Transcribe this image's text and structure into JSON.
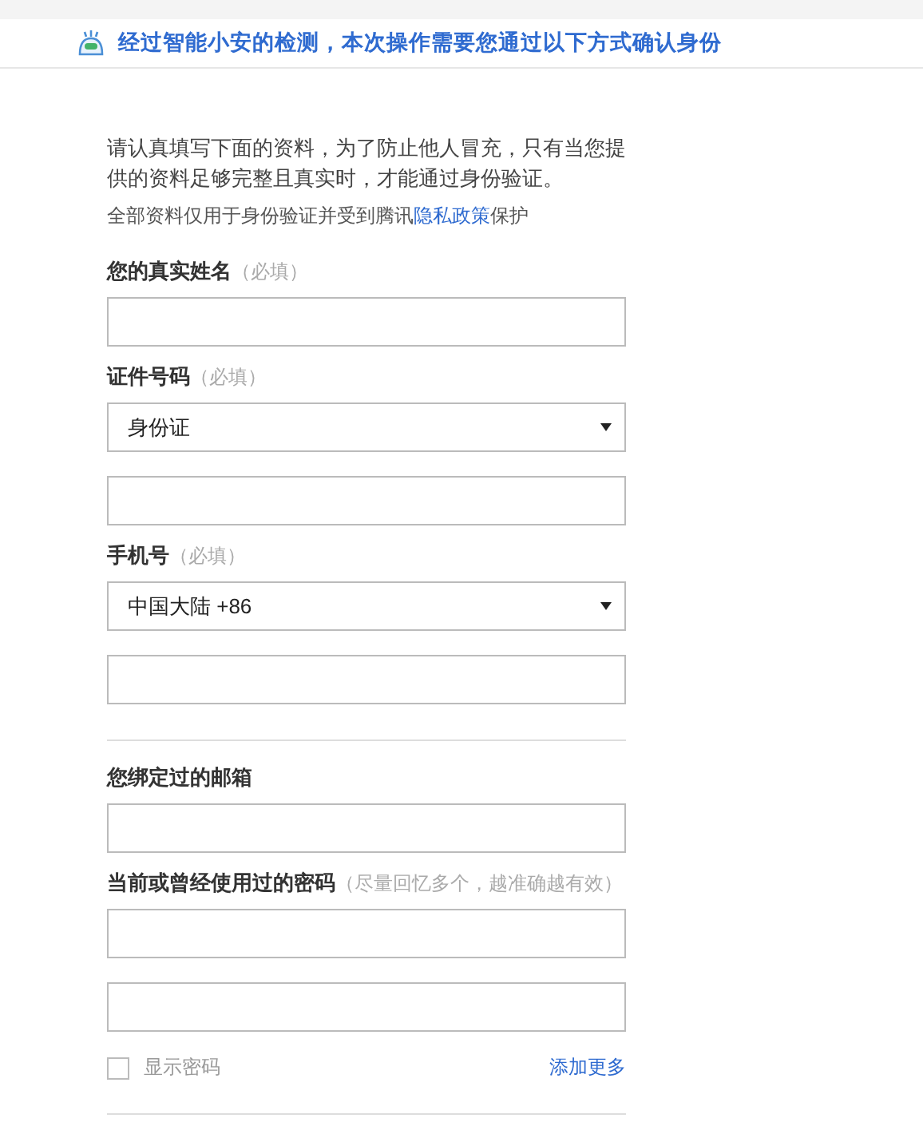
{
  "banner": {
    "text": "经过智能小安的检测，本次操作需要您通过以下方式确认身份"
  },
  "intro": "请认真填写下面的资料，为了防止他人冒充，只有当您提供的资料足够完整且真实时，才能通过身份验证。",
  "privacy": {
    "prefix": "全部资料仅用于身份验证并受到腾讯",
    "link": "隐私政策",
    "suffix": "保护"
  },
  "items": [
    {
      "kind": "field",
      "label": "您的真实姓名",
      "hint": "（必填）",
      "controls": [
        {
          "kind": "input"
        }
      ]
    },
    {
      "kind": "field",
      "label": "证件号码",
      "hint": "（必填）",
      "controls": [
        {
          "kind": "select",
          "value": "身份证"
        },
        {
          "kind": "input"
        }
      ]
    },
    {
      "kind": "field",
      "label": "手机号",
      "hint": "（必填）",
      "controls": [
        {
          "kind": "select",
          "value": "中国大陆 +86"
        },
        {
          "kind": "input"
        }
      ]
    },
    {
      "kind": "divider"
    },
    {
      "kind": "field",
      "label": "您绑定过的邮箱",
      "controls": [
        {
          "kind": "input"
        }
      ]
    },
    {
      "kind": "field",
      "label": "当前或曾经使用过的密码",
      "hint": "（尽量回忆多个，越准确越有效）",
      "controls": [
        {
          "kind": "input"
        },
        {
          "kind": "input"
        }
      ]
    },
    {
      "kind": "options",
      "checkbox": {
        "label": "显示密码",
        "checked": false
      },
      "link": "添加更多"
    },
    {
      "kind": "divider"
    }
  ]
}
